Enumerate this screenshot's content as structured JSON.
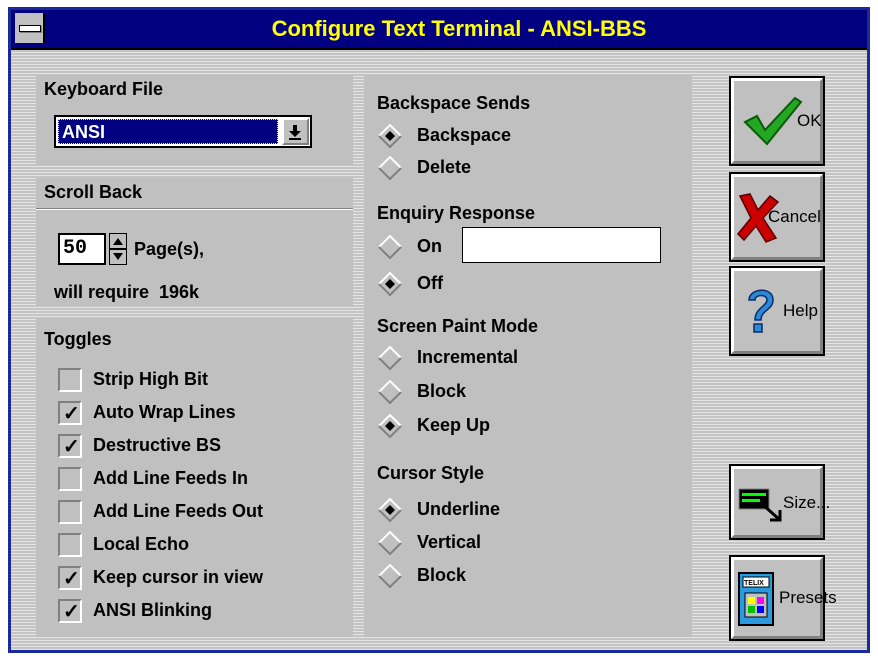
{
  "window": {
    "title": "Configure Text Terminal - ANSI-BBS"
  },
  "keyboard": {
    "label": "Keyboard File",
    "value": "ANSI"
  },
  "scrollback": {
    "label": "Scroll Back",
    "pages": "50",
    "pages_unit": "Page(s),",
    "requires": "will require  196k"
  },
  "toggles": {
    "label": "Toggles",
    "items": [
      {
        "label": "Strip High Bit",
        "checked": false
      },
      {
        "label": "Auto Wrap Lines",
        "checked": true
      },
      {
        "label": "Destructive BS",
        "checked": true
      },
      {
        "label": "Add Line Feeds In",
        "checked": false
      },
      {
        "label": "Add Line Feeds Out",
        "checked": false
      },
      {
        "label": "Local Echo",
        "checked": false
      },
      {
        "label": "Keep cursor in view",
        "checked": true
      },
      {
        "label": "ANSI Blinking",
        "checked": true
      }
    ],
    "check_mark": "✓"
  },
  "backspace": {
    "label": "Backspace Sends",
    "options": [
      "Backspace",
      "Delete"
    ],
    "selected": "Backspace"
  },
  "enquiry": {
    "label": "Enquiry Response",
    "options": [
      "On",
      "Off"
    ],
    "selected": "Off",
    "response_text": ""
  },
  "paint": {
    "label": "Screen Paint Mode",
    "options": [
      "Incremental",
      "Block",
      "Keep Up"
    ],
    "selected": "Keep Up"
  },
  "cursor": {
    "label": "Cursor Style",
    "options": [
      "Underline",
      "Vertical",
      "Block"
    ],
    "selected": "Underline"
  },
  "buttons": {
    "ok": "OK",
    "cancel": "Cancel",
    "help": "Help",
    "size": "Size...",
    "presets": "Presets",
    "presets_icon_text": "TELIX"
  },
  "colors": {
    "titlebar": "#000080",
    "title_text": "#ffff00",
    "face": "#c0c0c0",
    "check_green": "#22a822",
    "cancel_red": "#cc0000",
    "help_blue": "#2a8ad8"
  }
}
